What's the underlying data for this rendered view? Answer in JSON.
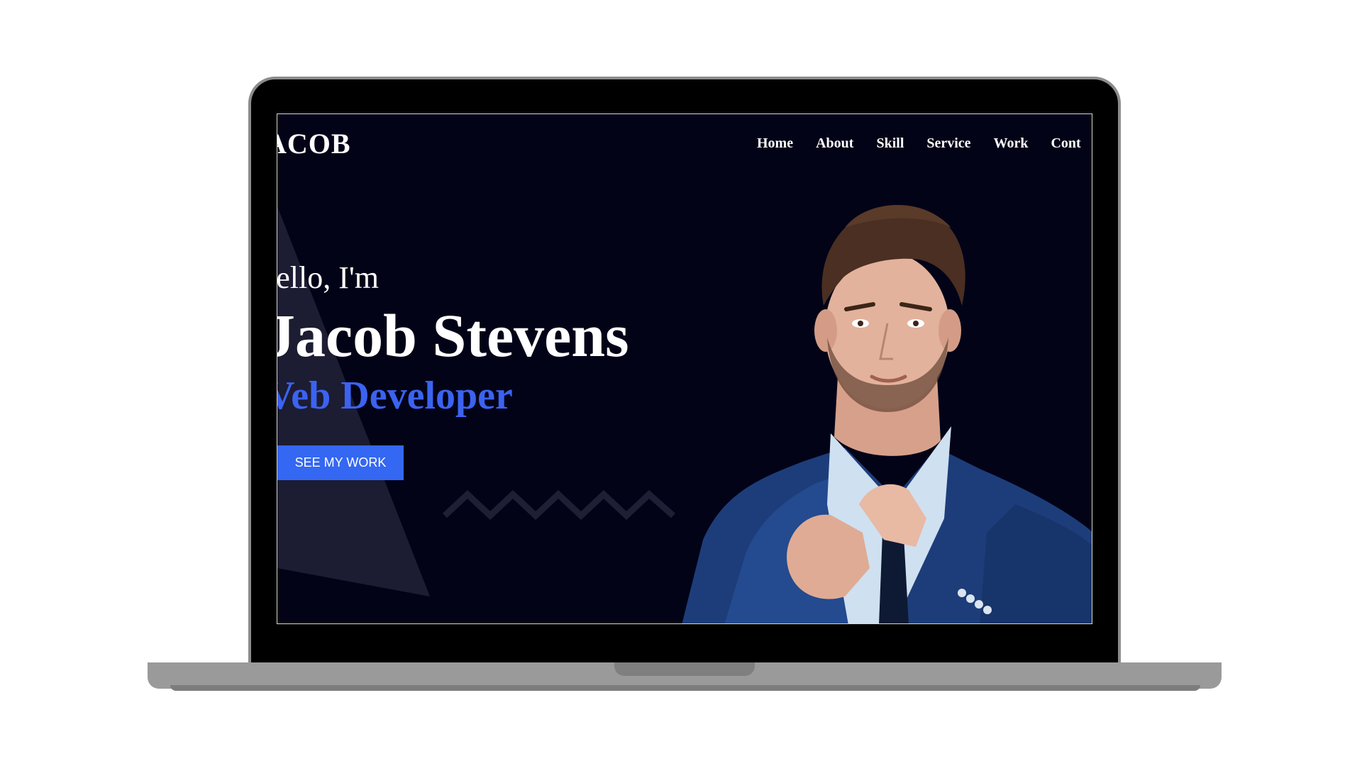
{
  "site": {
    "brand": "ACOB",
    "nav": [
      "Home",
      "About",
      "Skill",
      "Service",
      "Work",
      "Cont"
    ]
  },
  "hero": {
    "greeting": "lello, I'm",
    "name": "Jacob Stevens",
    "role": "Veb Developer",
    "cta_label": "SEE MY WORK"
  },
  "colors": {
    "background": "#030318",
    "accent": "#3b63f0",
    "text": "#ffffff",
    "decor": "#1c1c33"
  },
  "icons": {
    "portrait": "man-in-blue-suit-photo",
    "zigzag": "zigzag-decoration",
    "triangle": "triangle-decoration"
  }
}
